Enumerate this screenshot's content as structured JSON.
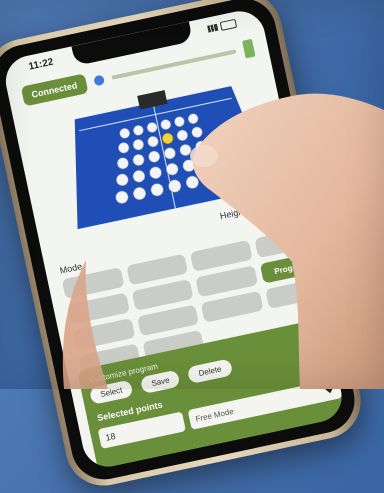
{
  "status_bar": {
    "time": "11:22"
  },
  "header": {
    "connection_label": "Connected"
  },
  "controls": {
    "height_label": "Height",
    "minus": "-",
    "plus": "+",
    "mode_label": "Mode"
  },
  "modes": [
    {
      "label": ""
    },
    {
      "label": ""
    },
    {
      "label": ""
    },
    {
      "label": ""
    },
    {
      "label": ""
    },
    {
      "label": ""
    },
    {
      "label": ""
    },
    {
      "label": "Program",
      "active": true
    },
    {
      "label": ""
    },
    {
      "label": ""
    },
    {
      "label": ""
    },
    {
      "label": ""
    },
    {
      "label": ""
    },
    {
      "label": ""
    }
  ],
  "program": {
    "title": "Customize program",
    "select_label": "Select",
    "save_label": "Save",
    "delete_label": "Delete"
  },
  "selected_points": {
    "title": "Selected points",
    "value": "18",
    "mode": "Free Mode"
  },
  "colors": {
    "accent": "#6a8f3a",
    "table_blue": "#1f4fb6",
    "background": "#4f79b4"
  }
}
